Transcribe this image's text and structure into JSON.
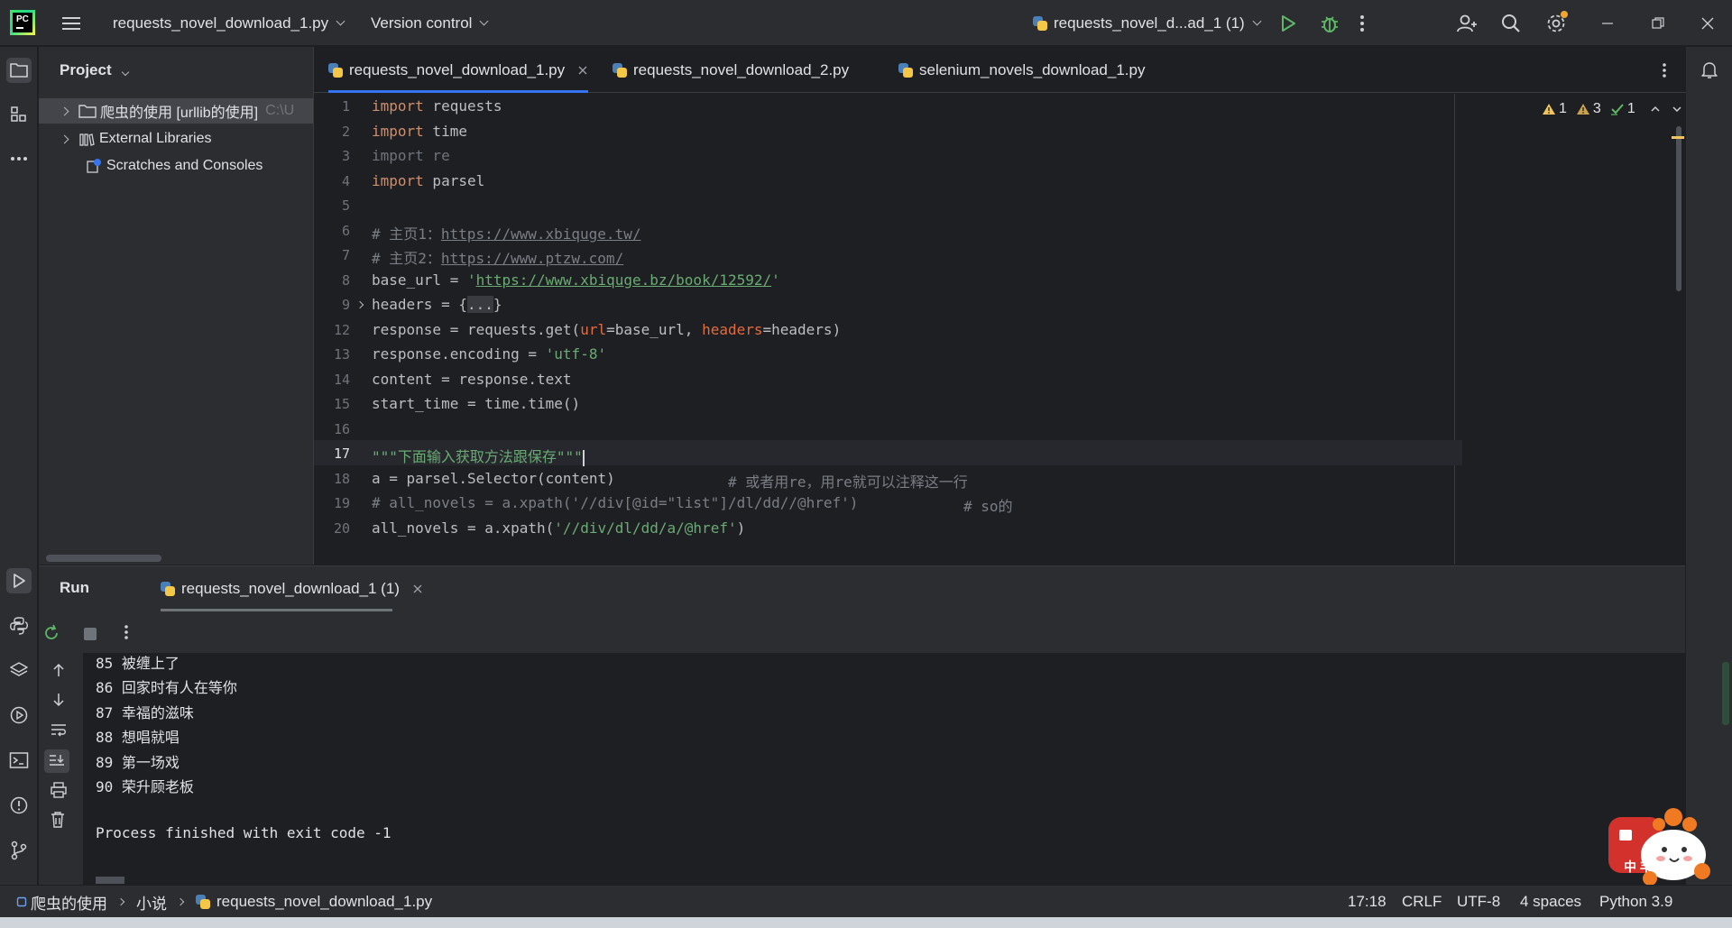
{
  "titlebar": {
    "project_name": "requests_novel_download_1.py",
    "vcs_label": "Version control",
    "run_config": "requests_novel_d...ad_1 (1)"
  },
  "project_panel": {
    "title": "Project",
    "items": [
      {
        "label": "爬虫的使用 [urllib的使用]",
        "path": "C:\\U"
      },
      {
        "label": "External Libraries"
      },
      {
        "label": "Scratches and Consoles"
      }
    ]
  },
  "editor": {
    "tabs": [
      {
        "label": "requests_novel_download_1.py",
        "active": true
      },
      {
        "label": "requests_novel_download_2.py",
        "active": false
      },
      {
        "label": "selenium_novels_download_1.py",
        "active": false
      }
    ],
    "inspections": {
      "warnings_a": "1",
      "warnings_b": "3",
      "ok": "1"
    },
    "line_numbers": [
      "1",
      "2",
      "3",
      "4",
      "5",
      "6",
      "7",
      "8",
      "9",
      "12",
      "13",
      "14",
      "15",
      "16",
      "17",
      "18",
      "19",
      "20"
    ],
    "current_line": "17",
    "code": {
      "l1_kw": "import",
      "l1_rest": " requests",
      "l2_kw": "import",
      "l2_rest": " time",
      "l3": "import re",
      "l4_kw": "import",
      "l4_rest": " parsel",
      "l6_cm": "# 主页1：",
      "l6_link": "https://www.xbiquge.tw/",
      "l7_cm": "# 主页2：",
      "l7_link": "https://www.ptzw.com/",
      "l8_a": "base_url = ",
      "l8_q1": "'",
      "l8_link": "https://www.xbiquge.bz/book/12592/",
      "l8_q2": "'",
      "l9_a": "headers = {",
      "l9_fold": "...",
      "l9_b": "}",
      "l12_a": "response = requests.get(",
      "l12_p1": "url",
      "l12_b": "=base_url, ",
      "l12_p2": "headers",
      "l12_c": "=headers)",
      "l13_a": "response.encoding = ",
      "l13_str": "'utf-8'",
      "l14": "content = response.text",
      "l15": "start_time = time.time()",
      "l17_str": "\"\"\"下面输入获取方法跟保存\"\"\"",
      "l18_a": "a = parsel.Selector(content)",
      "l18_cm": "# 或者用re，用re就可以注释这一行",
      "l19_cm": "# all_novels = a.xpath('//div[@id=\"list\"]/dl/dd//@href')",
      "l19_cm2": "# so的",
      "l20_a": "all_novels = a.xpath(",
      "l20_str": "'//div/dl/dd/a/@href'",
      "l20_b": ")"
    }
  },
  "run": {
    "title": "Run",
    "tab_label": "requests_novel_download_1 (1)",
    "output": [
      "85 被缠上了",
      "86 回家时有人在等你",
      "87 幸福的滋味",
      "88 想唱就唱",
      "89 第一场戏",
      "90 荣升顾老板",
      "",
      "Process finished with exit code -1"
    ]
  },
  "statusbar": {
    "crumb1": "爬虫的使用",
    "crumb2": "小说",
    "crumb3": "requests_novel_download_1.py",
    "position": "17:18",
    "line_sep": "CRLF",
    "encoding": "UTF-8",
    "indent": "4 spaces",
    "interpreter": "Python 3.9"
  },
  "mascot_text": "中 丰"
}
